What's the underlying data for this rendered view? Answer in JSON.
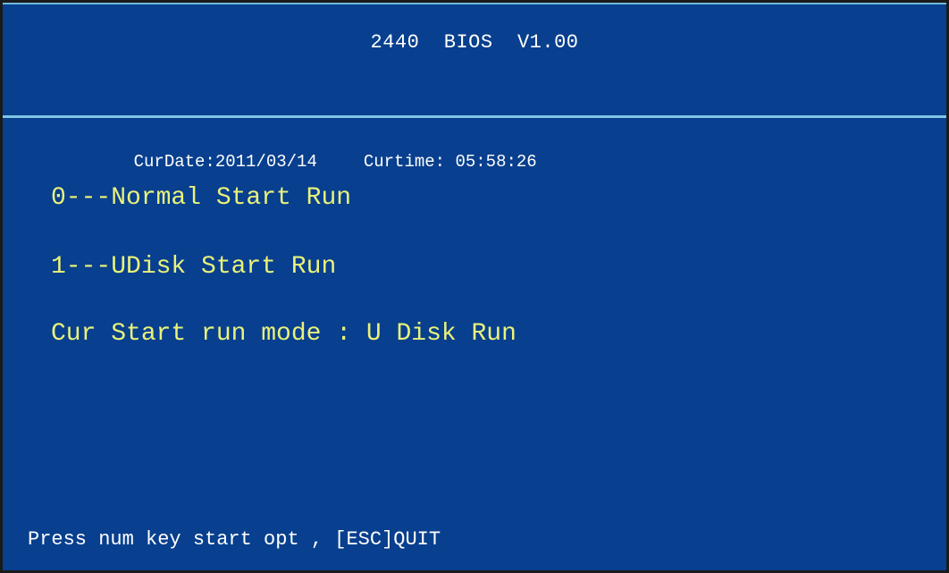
{
  "header": {
    "title": "2440  BIOS  V1.00"
  },
  "status": {
    "date_label": "CurDate:2011/03/14",
    "time_label": "Curtime: 05:58:26"
  },
  "menu": {
    "options": [
      {
        "label": "0---Normal Start Run"
      },
      {
        "label": "1---UDisk Start Run"
      }
    ],
    "current_mode": "Cur Start run mode : U Disk Run"
  },
  "footer": {
    "hint": "Press num key start opt , [ESC]QUIT"
  },
  "colors": {
    "background": "#083f8e",
    "menu_text": "#e9f27a",
    "title_text": "#ffffff",
    "divider": "#7ec6e6"
  }
}
